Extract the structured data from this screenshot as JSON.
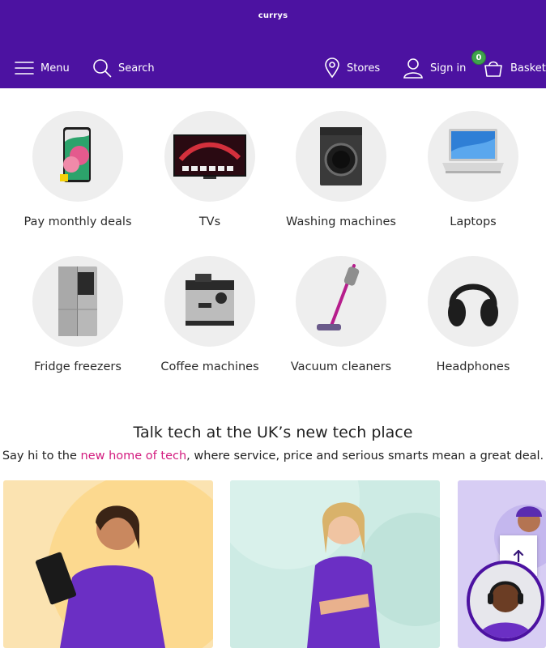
{
  "header": {
    "logo": "currys",
    "menu_label": "Menu",
    "search_label": "Search",
    "stores_label": "Stores",
    "signin_label": "Sign in",
    "basket_label": "Basket",
    "basket_count": "0",
    "background": "#4c12a1"
  },
  "categories": [
    {
      "label": "Pay monthly deals",
      "icon": "smartphone-image"
    },
    {
      "label": "TVs",
      "icon": "tv-image"
    },
    {
      "label": "Washing machines",
      "icon": "washing-machine-image"
    },
    {
      "label": "Laptops",
      "icon": "laptop-image"
    },
    {
      "label": "Fridge freezers",
      "icon": "fridge-freezer-image"
    },
    {
      "label": "Coffee machines",
      "icon": "coffee-machine-image"
    },
    {
      "label": "Vacuum cleaners",
      "icon": "vacuum-cleaner-image"
    },
    {
      "label": "Headphones",
      "icon": "headphones-image"
    }
  ],
  "promo": {
    "title": "Talk tech at the UK’s new tech place",
    "sub_before": "Say hi to the ",
    "sub_link": "new home of tech",
    "sub_after": ", where service, price and serious smarts mean a great deal.",
    "link_color": "#d31c7f"
  }
}
